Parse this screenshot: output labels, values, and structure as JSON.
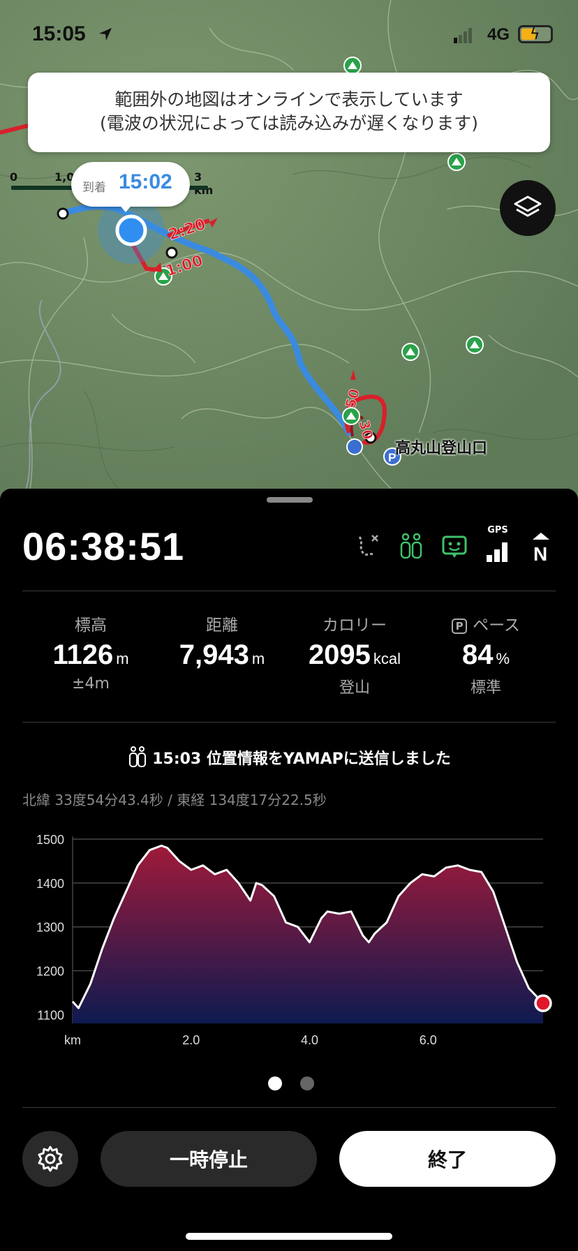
{
  "status_bar": {
    "time": "15:05",
    "network": "4G",
    "battery_level": 0.5,
    "battery_charging": true
  },
  "map": {
    "toast_line1": "範囲外の地図はオンラインで表示しています",
    "toast_line2": "(電波の状況によっては読み込みが遅くなります)",
    "scale_labels": [
      "0",
      "1,0",
      "3 km"
    ],
    "arrival_label": "到着",
    "arrival_time": "15:02",
    "route_times": [
      "2:20",
      "1:00",
      "50",
      "30"
    ],
    "trailhead_label": "高丸山登山口",
    "colors": {
      "route_blue": "#3a8be0",
      "route_red": "#d8202a",
      "peak_green": "#2aa24a"
    }
  },
  "panel": {
    "elapsed_time": "06:38:51",
    "header_icons": [
      "route-off-icon",
      "buddy-share-icon",
      "map-view-icon",
      "gps-signal-icon",
      "north-up-icon"
    ],
    "gps_label": "GPS",
    "north_label": "N",
    "stats": [
      {
        "label": "標高",
        "value": "1126",
        "unit": "m",
        "sub": "±4m"
      },
      {
        "label": "距離",
        "value": "7,943",
        "unit": "m",
        "sub": ""
      },
      {
        "label": "カロリー",
        "value": "2095",
        "unit": "kcal",
        "sub": "登山"
      },
      {
        "label": "ペース",
        "badge": "P",
        "value": "84",
        "unit": "%",
        "sub": "標準"
      }
    ],
    "sent_message": "15:03 位置情報をYAMAPに送信しました",
    "coordinates": "北緯 33度54分43.4秒 / 東経 134度17分22.5秒",
    "pause_label": "一時停止",
    "end_label": "終了",
    "page_index": 0,
    "page_count": 2
  },
  "chart_data": {
    "type": "area",
    "xlabel": "km",
    "ylabel": "",
    "x_ticks": [
      "2.0",
      "4.0",
      "6.0"
    ],
    "y_ticks": [
      1500,
      1400,
      1300,
      1200,
      1100
    ],
    "xlim": [
      0,
      7.94
    ],
    "ylim": [
      1080,
      1500
    ],
    "grid": true,
    "series": [
      {
        "x": [
          0,
          0.1,
          0.3,
          0.5,
          0.7,
          0.9,
          1.1,
          1.3,
          1.5,
          1.6,
          1.8,
          2.0,
          2.2,
          2.4,
          2.6,
          2.8,
          3.0,
          3.1,
          3.2,
          3.4,
          3.6,
          3.8,
          4.0,
          4.2,
          4.3,
          4.5,
          4.7,
          4.9,
          5.0,
          5.1,
          5.3,
          5.5,
          5.7,
          5.9,
          6.1,
          6.3,
          6.5,
          6.7,
          6.9,
          7.1,
          7.3,
          7.5,
          7.7,
          7.94
        ],
        "y": [
          1130,
          1115,
          1170,
          1250,
          1320,
          1380,
          1440,
          1475,
          1485,
          1480,
          1450,
          1430,
          1440,
          1420,
          1430,
          1400,
          1360,
          1400,
          1395,
          1370,
          1310,
          1300,
          1265,
          1320,
          1335,
          1330,
          1335,
          1280,
          1265,
          1285,
          1310,
          1370,
          1400,
          1420,
          1415,
          1435,
          1440,
          1430,
          1425,
          1380,
          1300,
          1220,
          1160,
          1126
        ]
      }
    ],
    "current_point": {
      "x": 7.94,
      "y": 1126
    },
    "colors": {
      "top": "#a01a3a",
      "bottom": "#0e1a50",
      "line": "#ffffff",
      "marker": "#e0182a"
    }
  }
}
